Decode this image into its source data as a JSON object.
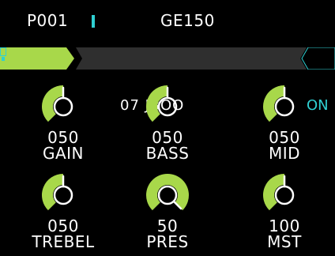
{
  "header": {
    "preset": "P001",
    "device": "GE150"
  },
  "module": {
    "type": "AMP",
    "model": "07 JBOO",
    "status": "ON",
    "accent": "#a8d84a",
    "status_color": "#2fd0d2"
  },
  "knobs": [
    {
      "value": "050",
      "label": "GAIN",
      "level": 0.5
    },
    {
      "value": "050",
      "label": "BASS",
      "level": 0.5
    },
    {
      "value": "050",
      "label": "MID",
      "level": 0.5
    },
    {
      "value": "050",
      "label": "TREBEL",
      "level": 0.5
    },
    {
      "value": "50",
      "label": "PRES",
      "level": 1.0
    },
    {
      "value": "100",
      "label": "MST",
      "level": 0.5
    }
  ]
}
